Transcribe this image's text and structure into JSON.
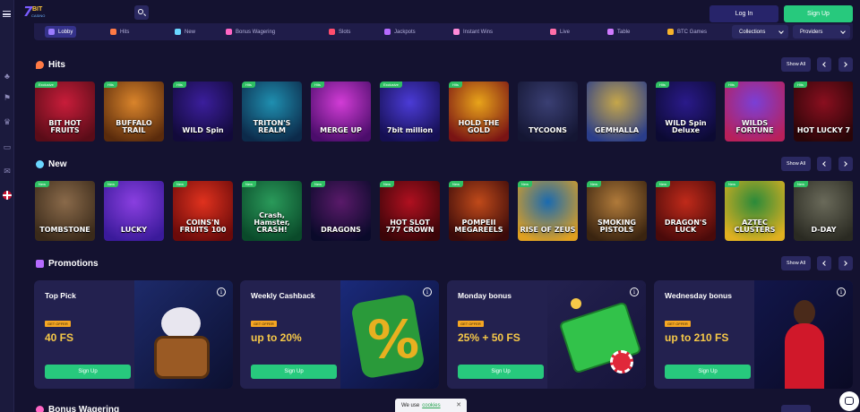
{
  "header": {
    "logo": {
      "mark": "7",
      "text": "BIT",
      "sub": "CASINO"
    },
    "login_label": "Log In",
    "signup_label": "Sign Up"
  },
  "categories": [
    {
      "label": "Lobby",
      "icon": "lobby-icon",
      "color": "#9b7cff"
    },
    {
      "label": "Hits",
      "icon": "fire-icon",
      "color": "#ff7a45"
    },
    {
      "label": "New",
      "icon": "sparkle-icon",
      "color": "#6ad7ff"
    },
    {
      "label": "Bonus Wagering",
      "icon": "bonus-icon",
      "color": "#ff66c4"
    },
    {
      "label": "Slots",
      "icon": "cherry-icon",
      "color": "#ff4d6d"
    },
    {
      "label": "Jackpots",
      "icon": "crown-icon",
      "color": "#b66bff"
    },
    {
      "label": "Instant Wins",
      "icon": "rocket-icon",
      "color": "#ff8ad8"
    },
    {
      "label": "Live",
      "icon": "live-icon",
      "color": "#ff6ea8"
    },
    {
      "label": "Table",
      "icon": "table-icon",
      "color": "#d07aff"
    },
    {
      "label": "BTC Games",
      "icon": "btc-icon",
      "color": "#f7b32b"
    }
  ],
  "filters": {
    "collections": "Collections",
    "providers": "Providers"
  },
  "hits": {
    "title": "Hits",
    "show_all": "Show All",
    "games": [
      {
        "name": "BIT HOT FRUITS",
        "badge": "Exclusive",
        "c1": "#c81d3a",
        "c2": "#5a0c18"
      },
      {
        "name": "BUFFALO TRAIL",
        "badge": "Hits",
        "c1": "#d9842b",
        "c2": "#5a2b0c"
      },
      {
        "name": "WILD Spin",
        "badge": "Hits",
        "c1": "#3b1e9c",
        "c2": "#120a3a"
      },
      {
        "name": "TRITON'S REALM",
        "badge": "Hits",
        "c1": "#1f8fb0",
        "c2": "#0c2a4a"
      },
      {
        "name": "MERGE UP",
        "badge": "Hits",
        "c1": "#d23cd6",
        "c2": "#4b0d6b"
      },
      {
        "name": "7bit million",
        "badge": "Exclusive",
        "c1": "#4b3bd6",
        "c2": "#150f52"
      },
      {
        "name": "HOLD THE GOLD",
        "badge": "Hits",
        "c1": "#e8a41a",
        "c2": "#7a1414"
      },
      {
        "name": "TYCOONS",
        "badge": "",
        "c1": "#3a3f73",
        "c2": "#141633"
      },
      {
        "name": "GEMHALLA",
        "badge": "",
        "c1": "#c5a64a",
        "c2": "#2a3d8a"
      },
      {
        "name": "WILD Spin Deluxe",
        "badge": "Hits",
        "c1": "#2a1a8a",
        "c2": "#0c0a33"
      },
      {
        "name": "WILDS FORTUNE",
        "badge": "Hits",
        "c1": "#7a3fd6",
        "c2": "#b8205a"
      },
      {
        "name": "HOT LUCKY 7",
        "badge": "Hits",
        "c1": "#8a0f1f",
        "c2": "#2a0508"
      }
    ]
  },
  "new": {
    "title": "New",
    "show_all": "Show All",
    "games": [
      {
        "name": "TOMBSTONE",
        "badge": "New",
        "c1": "#8a6a4a",
        "c2": "#3a2a1a"
      },
      {
        "name": "LUCKY",
        "badge": "New",
        "c1": "#8a3fe0",
        "c2": "#3a1a9a"
      },
      {
        "name": "COINS'N FRUITS 100",
        "badge": "New",
        "c1": "#e0321e",
        "c2": "#6a0a0a"
      },
      {
        "name": "Crash, Hamster, CRASH!",
        "badge": "New",
        "c1": "#2a9a5a",
        "c2": "#0a4a2a"
      },
      {
        "name": "DRAGONS",
        "badge": "New",
        "c1": "#5a1a6a",
        "c2": "#0a0a2a"
      },
      {
        "name": "HOT SLOT 777 CROWN",
        "badge": "New",
        "c1": "#b01020",
        "c2": "#3a0508"
      },
      {
        "name": "POMPEII MEGAREELS",
        "badge": "New",
        "c1": "#c04a1a",
        "c2": "#3a0a0a"
      },
      {
        "name": "RISE OF ZEUS",
        "badge": "New",
        "c1": "#1a6ab0",
        "c2": "#e0a020"
      },
      {
        "name": "SMOKING PISTOLS",
        "badge": "New",
        "c1": "#b07a3a",
        "c2": "#3a2410"
      },
      {
        "name": "DRAGON'S LUCK",
        "badge": "New",
        "c1": "#c02a1a",
        "c2": "#4a0a0a"
      },
      {
        "name": "AZTEC CLUSTERS",
        "badge": "New",
        "c1": "#2a8a3a",
        "c2": "#e0b020"
      },
      {
        "name": "D-DAY",
        "badge": "New",
        "c1": "#6a6a5a",
        "c2": "#2a2a22"
      }
    ]
  },
  "promotions": {
    "title": "Promotions",
    "show_all": "Show All",
    "offer_label": "GET OFFER",
    "cards": [
      {
        "title": "Top Pick",
        "value": "40 FS",
        "button": "Sign Up"
      },
      {
        "title": "Weekly Cashback",
        "value": "up to 20%",
        "button": "Sign Up"
      },
      {
        "title": "Monday bonus",
        "value": "25% + 50 FS",
        "button": "Sign Up"
      },
      {
        "title": "Wednesday bonus",
        "value": "up to 210 FS",
        "button": "Sign Up"
      }
    ]
  },
  "bonus_wagering": {
    "title": "Bonus Wagering"
  },
  "cookie": {
    "text": "We use",
    "link": "cookies",
    "close": "✕"
  }
}
